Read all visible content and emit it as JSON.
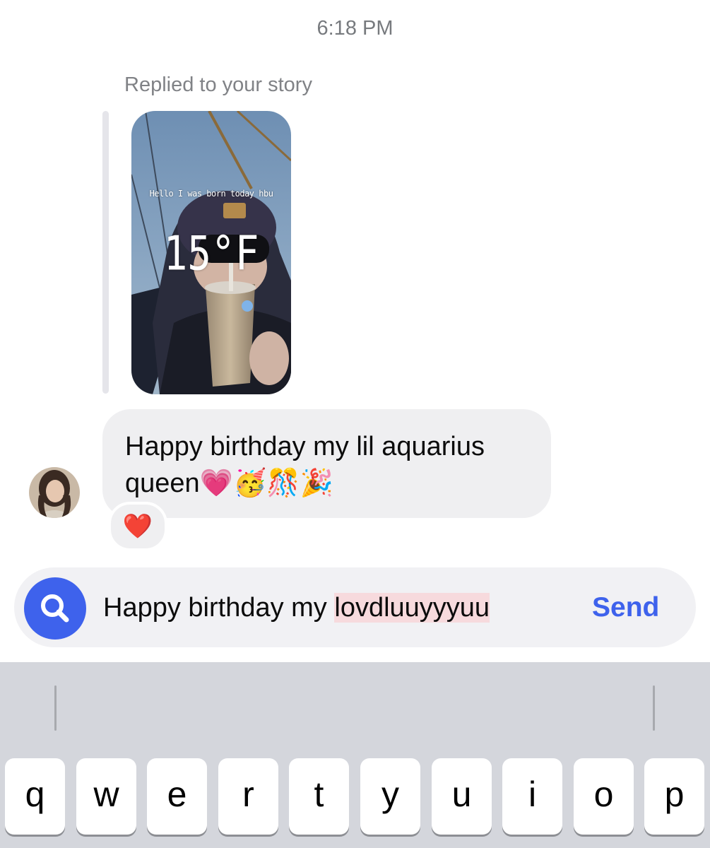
{
  "timestamp": "6:18 PM",
  "story_reply": {
    "label": "Replied to your story",
    "caption": "Hello I was born today hbu",
    "temperature": "15°F"
  },
  "message": {
    "line1": "Happy birthday my lil aquarius",
    "line2": "queen💗🥳🎊🎉",
    "reaction": "❤️"
  },
  "composer": {
    "text_plain": "Happy birthday my ",
    "text_misspelled": "lovdluuyyyuu",
    "send_label": "Send"
  },
  "keyboard": {
    "row1": [
      "q",
      "w",
      "e",
      "r",
      "t",
      "y",
      "u",
      "i",
      "o",
      "p"
    ]
  },
  "colors": {
    "accent": "#3e62ec",
    "bubble": "#efeff1",
    "misspelled_highlight": "#f7dadd",
    "keyboard_bg": "#d4d6dc"
  }
}
